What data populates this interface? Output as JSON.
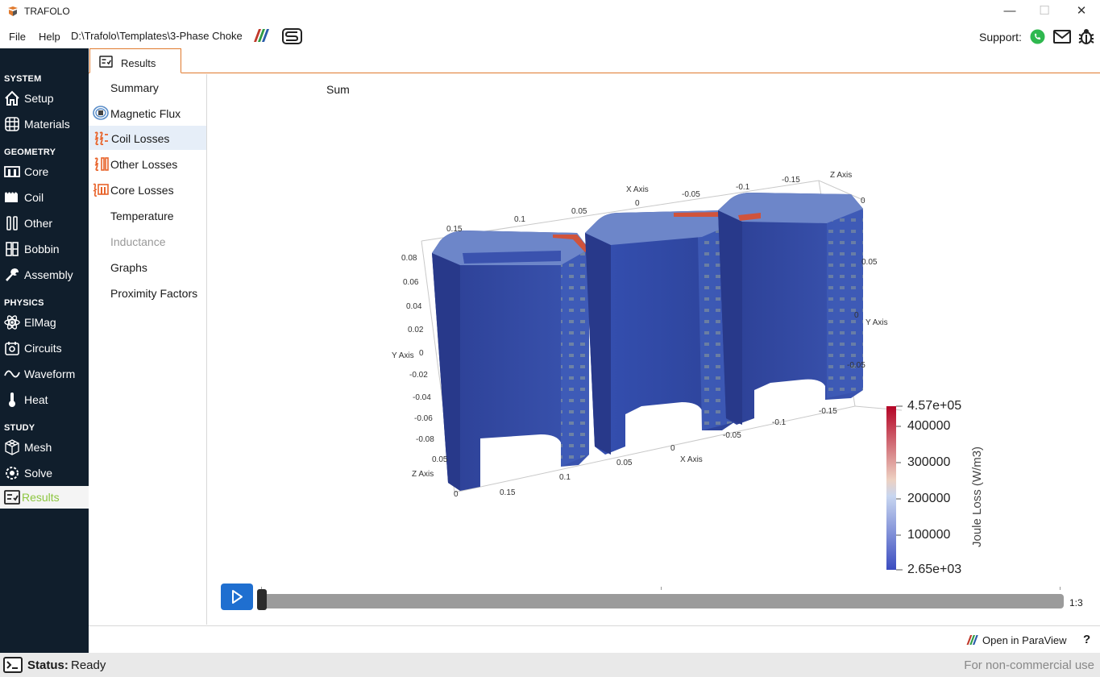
{
  "window": {
    "title": "TRAFOLO",
    "minimize_glyph": "—",
    "maximize_glyph": "☐",
    "close_glyph": "✕"
  },
  "menu": {
    "file": "File",
    "help": "Help",
    "path": "D:\\Trafolo\\Templates\\3-Phase Choke",
    "support": "Support:"
  },
  "sidebar": {
    "sections": {
      "system": "SYSTEM",
      "geometry": "GEOMETRY",
      "physics": "PHYSICS",
      "study": "STUDY"
    },
    "items": [
      {
        "label": "Setup",
        "icon": "home-icon"
      },
      {
        "label": "Materials",
        "icon": "grid-globe-icon"
      },
      {
        "label": "Core",
        "icon": "core-icon"
      },
      {
        "label": "Coil",
        "icon": "coil-icon"
      },
      {
        "label": "Other",
        "icon": "other-icon"
      },
      {
        "label": "Bobbin",
        "icon": "bobbin-icon"
      },
      {
        "label": "Assembly",
        "icon": "wrench-icon"
      },
      {
        "label": "ElMag",
        "icon": "atom-icon"
      },
      {
        "label": "Circuits",
        "icon": "circuit-icon"
      },
      {
        "label": "Waveform",
        "icon": "wave-icon"
      },
      {
        "label": "Heat",
        "icon": "thermometer-icon"
      },
      {
        "label": "Mesh",
        "icon": "mesh-icon"
      },
      {
        "label": "Solve",
        "icon": "solve-icon"
      },
      {
        "label": "Results",
        "icon": "results-icon"
      }
    ]
  },
  "tab": {
    "label": "Results"
  },
  "subnav": {
    "items": [
      {
        "label": "Summary"
      },
      {
        "label": "Magnetic Flux"
      },
      {
        "label": "Coil Losses"
      },
      {
        "label": "Other Losses"
      },
      {
        "label": "Core Losses"
      },
      {
        "label": "Temperature"
      },
      {
        "label": "Inductance"
      },
      {
        "label": "Graphs"
      },
      {
        "label": "Proximity Factors"
      }
    ],
    "selected": "Coil Losses",
    "disabled": "Inductance"
  },
  "viewer": {
    "title": "Sum",
    "colorbar": {
      "label": "Joule Loss (W/m3)",
      "max": "4.57e+05",
      "min": "2.65e+03",
      "ticks": [
        "400000",
        "300000",
        "200000",
        "100000"
      ],
      "colors": [
        "#3b4cc0",
        "#c8d6f0",
        "#b40426"
      ]
    },
    "axes": {
      "y_left": {
        "title": "Y Axis",
        "ticks": [
          "0.08",
          "0.06",
          "0.04",
          "0.02",
          "0",
          "-0.02",
          "-0.04",
          "-0.06",
          "-0.08"
        ]
      },
      "x_top": {
        "title": "X Axis",
        "ticks": [
          "0.15",
          "0.1",
          "0.05",
          "0",
          "-0.05",
          "-0.1",
          "-0.15"
        ]
      },
      "z_top": {
        "title": "Z Axis",
        "ticks": [
          "0"
        ]
      },
      "y_right": {
        "title": "Y Axis",
        "ticks": [
          "0.05",
          "0",
          "-0.05"
        ]
      },
      "x_bottom": {
        "title": "X Axis",
        "ticks": [
          "0.15",
          "0.1",
          "0.05",
          "0",
          "-0.05",
          "-0.1",
          "-0.15"
        ]
      },
      "z_left": {
        "title": "Z Axis",
        "ticks": [
          "0.05",
          "0"
        ]
      }
    }
  },
  "player": {
    "frame": "1:3",
    "position": 0.0
  },
  "bottom": {
    "paraview": "Open in ParaView",
    "help": "?"
  },
  "status": {
    "label": "Status:",
    "value": "Ready",
    "note": "For non-commercial use"
  }
}
